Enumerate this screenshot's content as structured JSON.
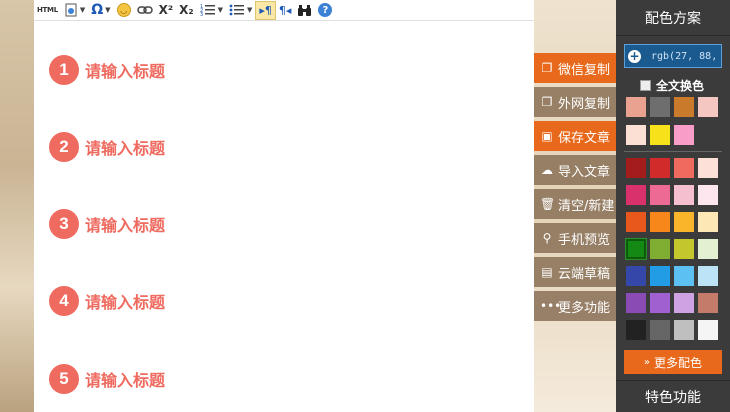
{
  "toolbar": {
    "html_label": "HTML",
    "omega": "Ω",
    "sup": "X²",
    "sub": "X₂",
    "para_ltr": "▸¶",
    "para_rtl": "¶◂",
    "binoculars": "⚯",
    "help": "?"
  },
  "headings": [
    {
      "num": "1",
      "text": "请输入标题"
    },
    {
      "num": "2",
      "text": "请输入标题"
    },
    {
      "num": "3",
      "text": "请输入标题"
    },
    {
      "num": "4",
      "text": "请输入标题"
    },
    {
      "num": "5",
      "text": "请输入标题"
    }
  ],
  "side_buttons": [
    {
      "label": "微信复制",
      "icon": "copy-icon",
      "style": "orange"
    },
    {
      "label": "外网复制",
      "icon": "copy-icon",
      "style": "brown"
    },
    {
      "label": "保存文章",
      "icon": "save-icon",
      "style": "orange"
    },
    {
      "label": "导入文章",
      "icon": "cloud-icon",
      "style": "brown"
    },
    {
      "label": "清空/新建",
      "icon": "trash-icon",
      "style": "brown"
    },
    {
      "label": "手机预览",
      "icon": "search-icon",
      "style": "brown"
    },
    {
      "label": "云端草稿",
      "icon": "document-icon",
      "style": "brown"
    },
    {
      "label": "更多功能",
      "icon": "more-icon",
      "style": "brown"
    }
  ],
  "panel": {
    "title": "配色方案",
    "color_value": "rgb(27, 88,",
    "all_change_label": "全文换色",
    "more_colors_label": "更多配色",
    "feature_title": "特色功能",
    "swatches_top": [
      [
        "#e9a28f",
        "#6e6e6e",
        "#c97a2a",
        "#f4c7c3"
      ],
      [
        "#fde0d4",
        "#f7e11a",
        "#f79dc8"
      ]
    ],
    "swatches_main": [
      [
        "#a31d1d",
        "#d22b2b",
        "#ef6a5f",
        "#fde0d8"
      ],
      [
        "#d9316b",
        "#ec6a94",
        "#f5bfd0",
        "#fde6ee"
      ],
      [
        "#e8571b",
        "#f7861b",
        "#fbb52b",
        "#fde8b5"
      ],
      [
        "#148a14",
        "#7fae32",
        "#c4c72b",
        "#e3f1d3"
      ],
      [
        "#3547a8",
        "#229ce4",
        "#5cc1f2",
        "#bde3f7"
      ],
      [
        "#8a4bb5",
        "#a160d0",
        "#cfa3e3",
        "#c57b6a"
      ],
      [
        "#222222",
        "#666666",
        "#bfbfbf",
        "#f5f5f5"
      ]
    ],
    "selected": "#148a14"
  }
}
